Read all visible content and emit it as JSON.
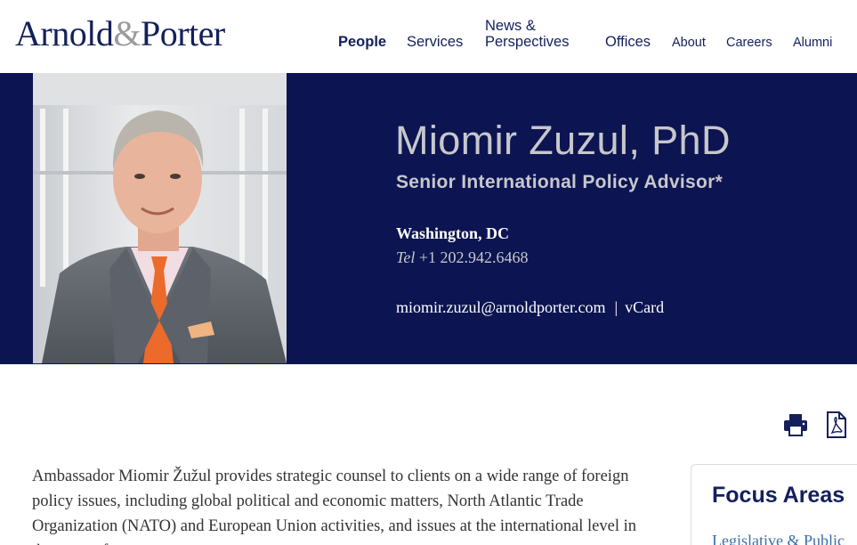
{
  "header": {
    "logo": {
      "part1": "Arnold",
      "amp": "&",
      "part2": "Porter"
    },
    "nav": [
      {
        "label": "People"
      },
      {
        "label": "Services"
      },
      {
        "label_line1": "News &",
        "label_line2": "Perspectives"
      },
      {
        "label": "Offices"
      },
      {
        "label": "About"
      },
      {
        "label": "Careers"
      },
      {
        "label": "Alumni"
      }
    ]
  },
  "profile": {
    "name": "Miomir Zuzul, PhD",
    "title": "Senior International Policy Advisor*",
    "office": "Washington, DC",
    "tel_label": "Tel",
    "tel": "+1 202.942.6468",
    "email": "miomir.zuzul@arnoldporter.com",
    "separator": "|",
    "vcard": "vCard"
  },
  "tools": {
    "print_icon": "printer-icon",
    "pdf_icon": "pdf-icon"
  },
  "bio": {
    "text": "Ambassador Miomir Žužul provides strategic counsel to clients on a wide range of foreign policy issues, including global political and economic matters, North Atlantic Trade Organization (NATO) and European Union activities, and issues at the international level in the areas of"
  },
  "focus_areas": {
    "heading": "Focus Areas",
    "items": [
      {
        "label": "Legislative & Public"
      }
    ]
  },
  "colors": {
    "brand_navy": "#13205b",
    "hero_bg": "#0c1551",
    "hero_text": "#c7c7cc",
    "link_blue": "#3b6ea8"
  }
}
